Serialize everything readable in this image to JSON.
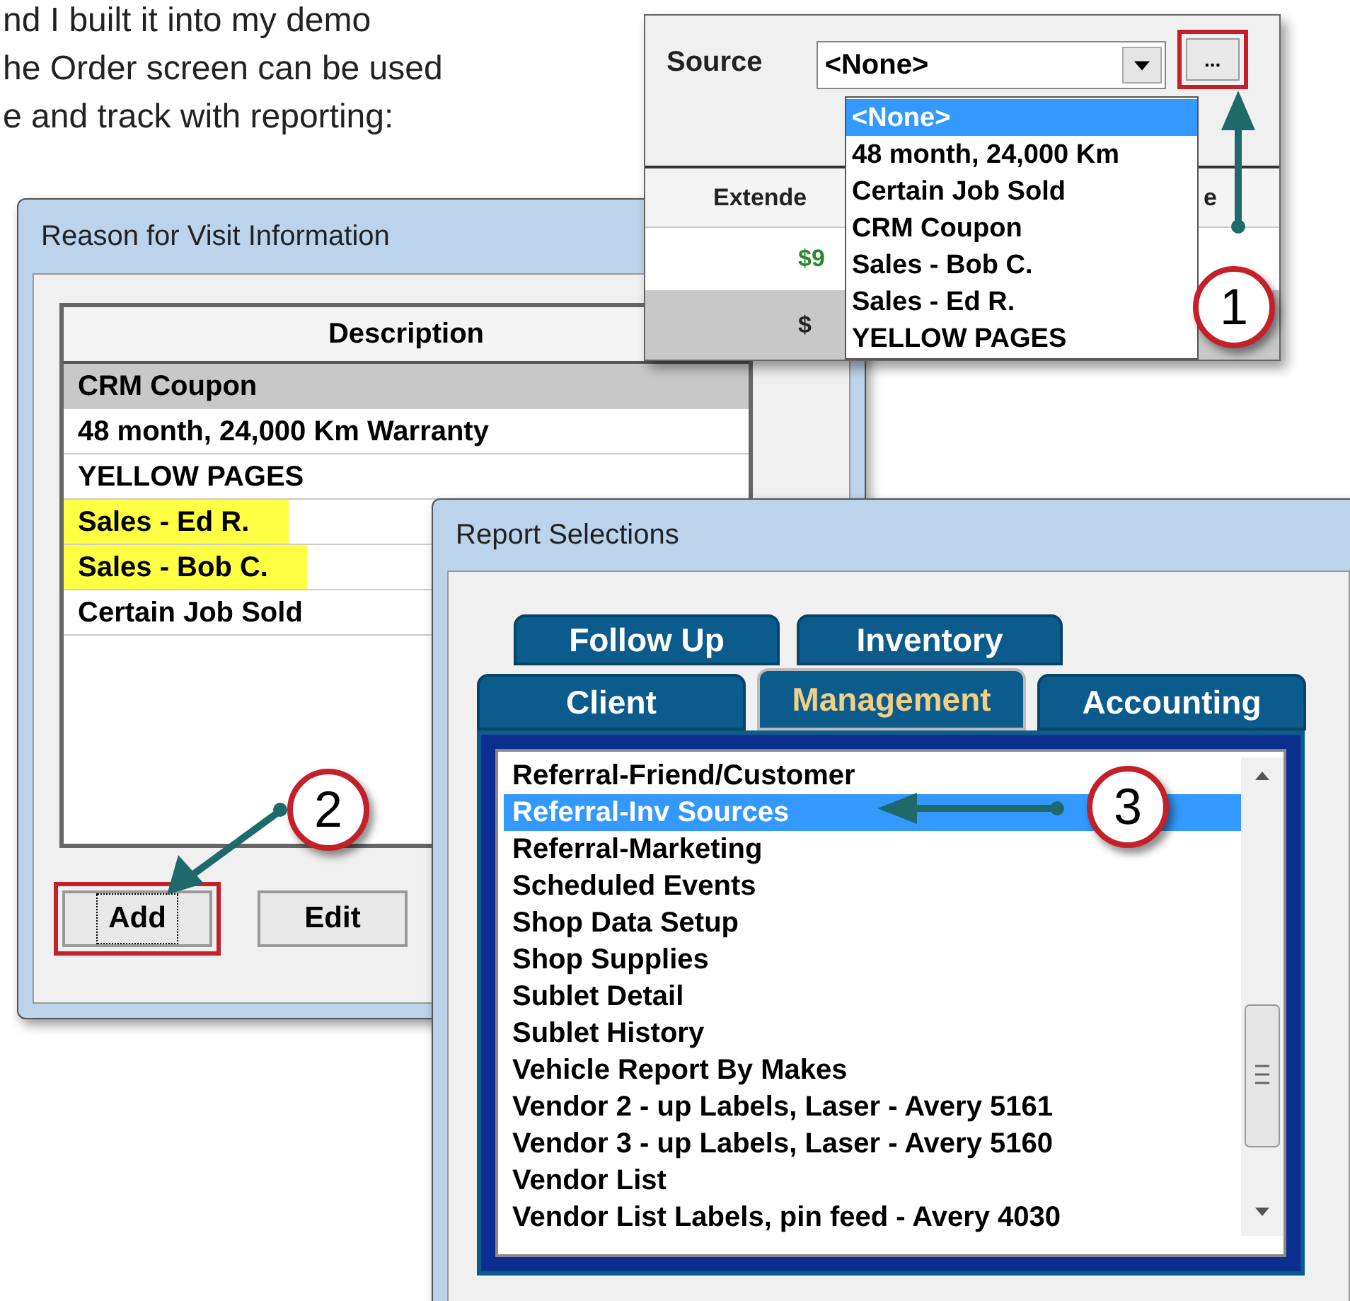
{
  "intro_text": [
    "nd I built it into my demo",
    "he Order screen can be used",
    "e and track with reporting:"
  ],
  "source_window": {
    "label": "Source",
    "combo_value": "<None>",
    "browse_button": "...",
    "browse_highlighted": true,
    "grid_columns": [
      "Extende",
      "e"
    ],
    "grid_cells": [
      "$9",
      "$"
    ],
    "dropdown": [
      {
        "label": "<None>",
        "selected": true
      },
      {
        "label": "48 month, 24,000 Km",
        "selected": false
      },
      {
        "label": "Certain Job Sold",
        "selected": false
      },
      {
        "label": "CRM Coupon",
        "selected": false
      },
      {
        "label": "Sales - Bob C.",
        "selected": false
      },
      {
        "label": "Sales - Ed R.",
        "selected": false
      },
      {
        "label": "YELLOW PAGES",
        "selected": false
      }
    ],
    "callout": "1"
  },
  "reason_window": {
    "title": "Reason for Visit Information",
    "column": "Description",
    "rows": [
      {
        "label": "CRM Coupon",
        "selected": true,
        "highlighted": false
      },
      {
        "label": "48 month, 24,000 Km Warranty",
        "selected": false,
        "highlighted": false
      },
      {
        "label": "YELLOW PAGES",
        "selected": false,
        "highlighted": false
      },
      {
        "label": "Sales - Ed R.",
        "selected": false,
        "highlighted": true
      },
      {
        "label": "Sales - Bob C.",
        "selected": false,
        "highlighted": true
      },
      {
        "label": "Certain Job Sold",
        "selected": false,
        "highlighted": false
      }
    ],
    "buttons": [
      {
        "label": "Add",
        "highlighted": true,
        "focused": true
      },
      {
        "label": "Edit",
        "highlighted": false,
        "focused": false
      }
    ],
    "callout": "2"
  },
  "report_window": {
    "title": "Report Selections",
    "tab_rows": [
      [
        {
          "label": "Follow Up",
          "selected": false
        },
        {
          "label": "Inventory",
          "selected": false
        }
      ],
      [
        {
          "label": "Client",
          "selected": false
        },
        {
          "label": "Management",
          "selected": true
        },
        {
          "label": "Accounting",
          "selected": false
        }
      ]
    ],
    "items": [
      {
        "label": "Referral-Friend/Customer",
        "selected": false
      },
      {
        "label": "Referral-Inv Sources",
        "selected": true
      },
      {
        "label": "Referral-Marketing",
        "selected": false
      },
      {
        "label": "Scheduled Events",
        "selected": false
      },
      {
        "label": "Shop Data Setup",
        "selected": false
      },
      {
        "label": "Shop Supplies",
        "selected": false
      },
      {
        "label": "Sublet Detail",
        "selected": false
      },
      {
        "label": "Sublet History",
        "selected": false
      },
      {
        "label": "Vehicle Report By Makes",
        "selected": false
      },
      {
        "label": "Vendor 2 - up Labels, Laser - Avery 5161",
        "selected": false
      },
      {
        "label": "Vendor 3 - up Labels, Laser - Avery 5160",
        "selected": false
      },
      {
        "label": "Vendor List",
        "selected": false
      },
      {
        "label": "Vendor List Labels, pin feed - Avery 4030",
        "selected": false
      }
    ],
    "callout": "3"
  }
}
